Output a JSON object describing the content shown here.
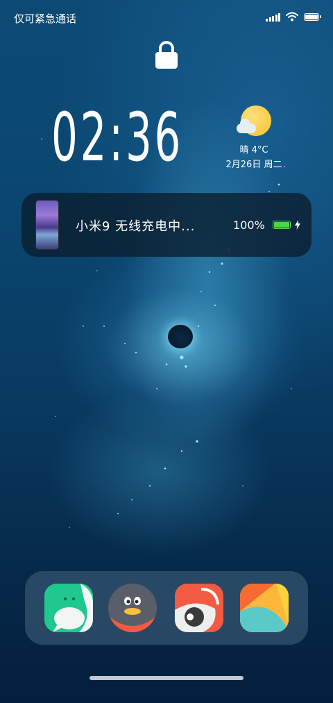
{
  "status_bar": {
    "left_text": "仅可紧急通话",
    "icons": [
      "signal-icon",
      "wifi-icon",
      "battery-icon"
    ]
  },
  "lock_screen": {
    "lock_icon": "lock-icon",
    "time": "02:36",
    "weather": {
      "icon": "partly-sunny-icon",
      "text": "晴 4°C",
      "date": "2月26日 周二"
    }
  },
  "notification": {
    "title": "小米9 无线充电中...",
    "percent": "100%",
    "battery_level": 1.0,
    "battery_color": "#44d84a"
  },
  "dock": {
    "apps": [
      {
        "name": "wechat-app-icon",
        "color": "#1ec88e"
      },
      {
        "name": "qq-app-icon",
        "color": "#5a5e68"
      },
      {
        "name": "weibo-app-icon",
        "color": "#f25a42"
      },
      {
        "name": "gallery-app-icon",
        "color": "#fdb83b"
      }
    ]
  }
}
